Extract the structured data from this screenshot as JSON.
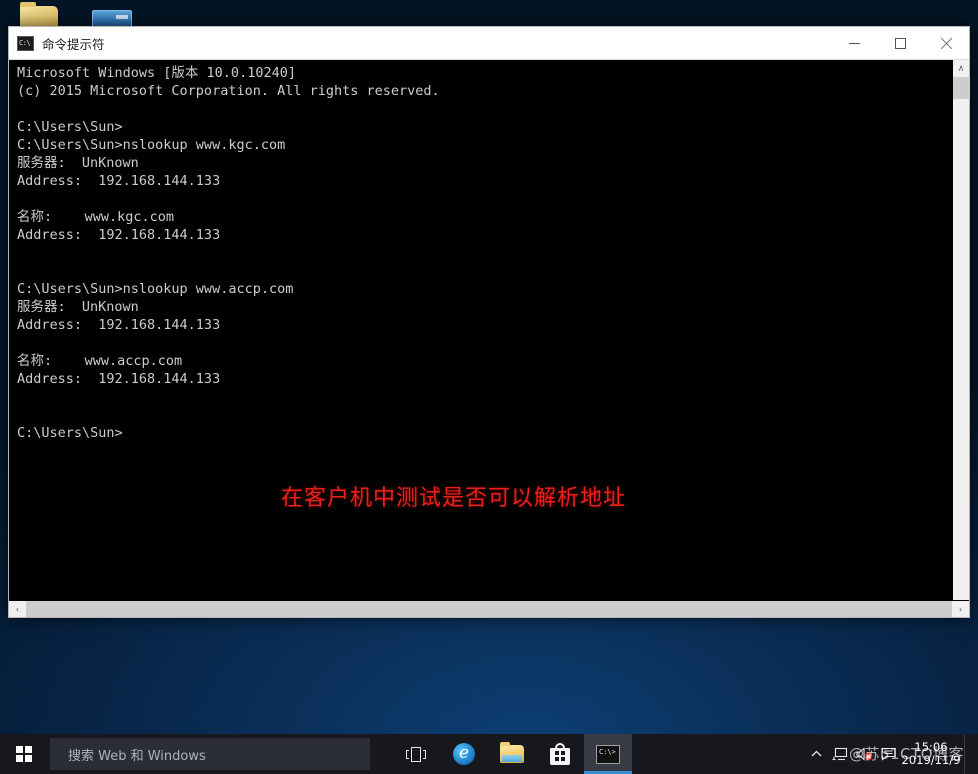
{
  "desktop": {
    "icons": [
      {
        "name": "folder-icon",
        "label": ""
      },
      {
        "name": "ie-icon",
        "label": ""
      }
    ]
  },
  "window": {
    "title": "命令提示符",
    "icon": "cmd-icon",
    "buttons": {
      "minimize": "─",
      "maximize": "□",
      "close": "✕"
    },
    "console": {
      "text": "Microsoft Windows [版本 10.0.10240]\n(c) 2015 Microsoft Corporation. All rights reserved.\n\nC:\\Users\\Sun>\nC:\\Users\\Sun>nslookup www.kgc.com\n服务器:  UnKnown\nAddress:  192.168.144.133\n\n名称:    www.kgc.com\nAddress:  192.168.144.133\n\n\nC:\\Users\\Sun>nslookup www.accp.com\n服务器:  UnKnown\nAddress:  192.168.144.133\n\n名称:    www.accp.com\nAddress:  192.168.144.133\n\n\nC:\\Users\\Sun>",
      "annotation": "在客户机中测试是否可以解析地址",
      "annotation_color": "#e8201a",
      "background_color": "#000000",
      "foreground_color": "#cccccc"
    },
    "scrollbars": {
      "v_up": "∧",
      "v_down": "∨",
      "h_left": "‹",
      "h_right": "›"
    }
  },
  "taskbar": {
    "start": "start-button",
    "search": {
      "placeholder": "搜索 Web 和 Windows",
      "value": ""
    },
    "items": [
      {
        "name": "taskview-button",
        "label": "Task View"
      },
      {
        "name": "edge-button",
        "label": "Microsoft Edge"
      },
      {
        "name": "file-explorer-button",
        "label": "File Explorer"
      },
      {
        "name": "store-button",
        "label": "Store"
      },
      {
        "name": "command-prompt-button",
        "label": "命令提示符",
        "active": true
      }
    ],
    "tray": {
      "chevron": "∧",
      "network": "network-icon",
      "volume": "volume-muted-icon",
      "action_center": "action-center-icon",
      "clock_time": "15:06",
      "clock_date": "2019/11/9"
    },
    "watermark": "@苏51CTO博客"
  }
}
